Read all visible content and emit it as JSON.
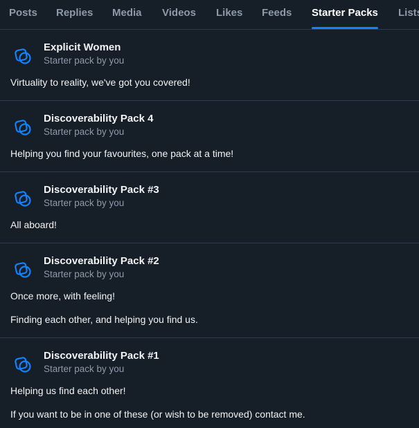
{
  "tabs": [
    {
      "label": "Posts"
    },
    {
      "label": "Replies"
    },
    {
      "label": "Media"
    },
    {
      "label": "Videos"
    },
    {
      "label": "Likes"
    },
    {
      "label": "Feeds"
    },
    {
      "label": "Starter Packs",
      "active": true
    },
    {
      "label": "Lists"
    }
  ],
  "accent_color": "#1083fe",
  "packs": [
    {
      "icon": "starter-pack-icon",
      "title": "Explicit Women",
      "subtitle": "Starter pack by you",
      "lines": [
        "Virtuality to reality, we've got you covered!"
      ]
    },
    {
      "icon": "starter-pack-icon",
      "title": "Discoverability Pack 4",
      "subtitle": "Starter pack by you",
      "lines": [
        "Helping you find your favourites, one pack at a time!"
      ]
    },
    {
      "icon": "starter-pack-icon",
      "title": "Discoverability Pack #3",
      "subtitle": "Starter pack by you",
      "lines": [
        "All aboard!"
      ]
    },
    {
      "icon": "starter-pack-icon",
      "title": "Discoverability Pack #2",
      "subtitle": "Starter pack by you",
      "lines": [
        "Once more, with feeling!",
        "Finding each other, and helping you find us."
      ]
    },
    {
      "icon": "starter-pack-icon",
      "title": "Discoverability Pack #1",
      "subtitle": "Starter pack by you",
      "lines": [
        "Helping us find each other!",
        "If you want to be in one of these (or wish to be removed) contact me."
      ]
    }
  ]
}
